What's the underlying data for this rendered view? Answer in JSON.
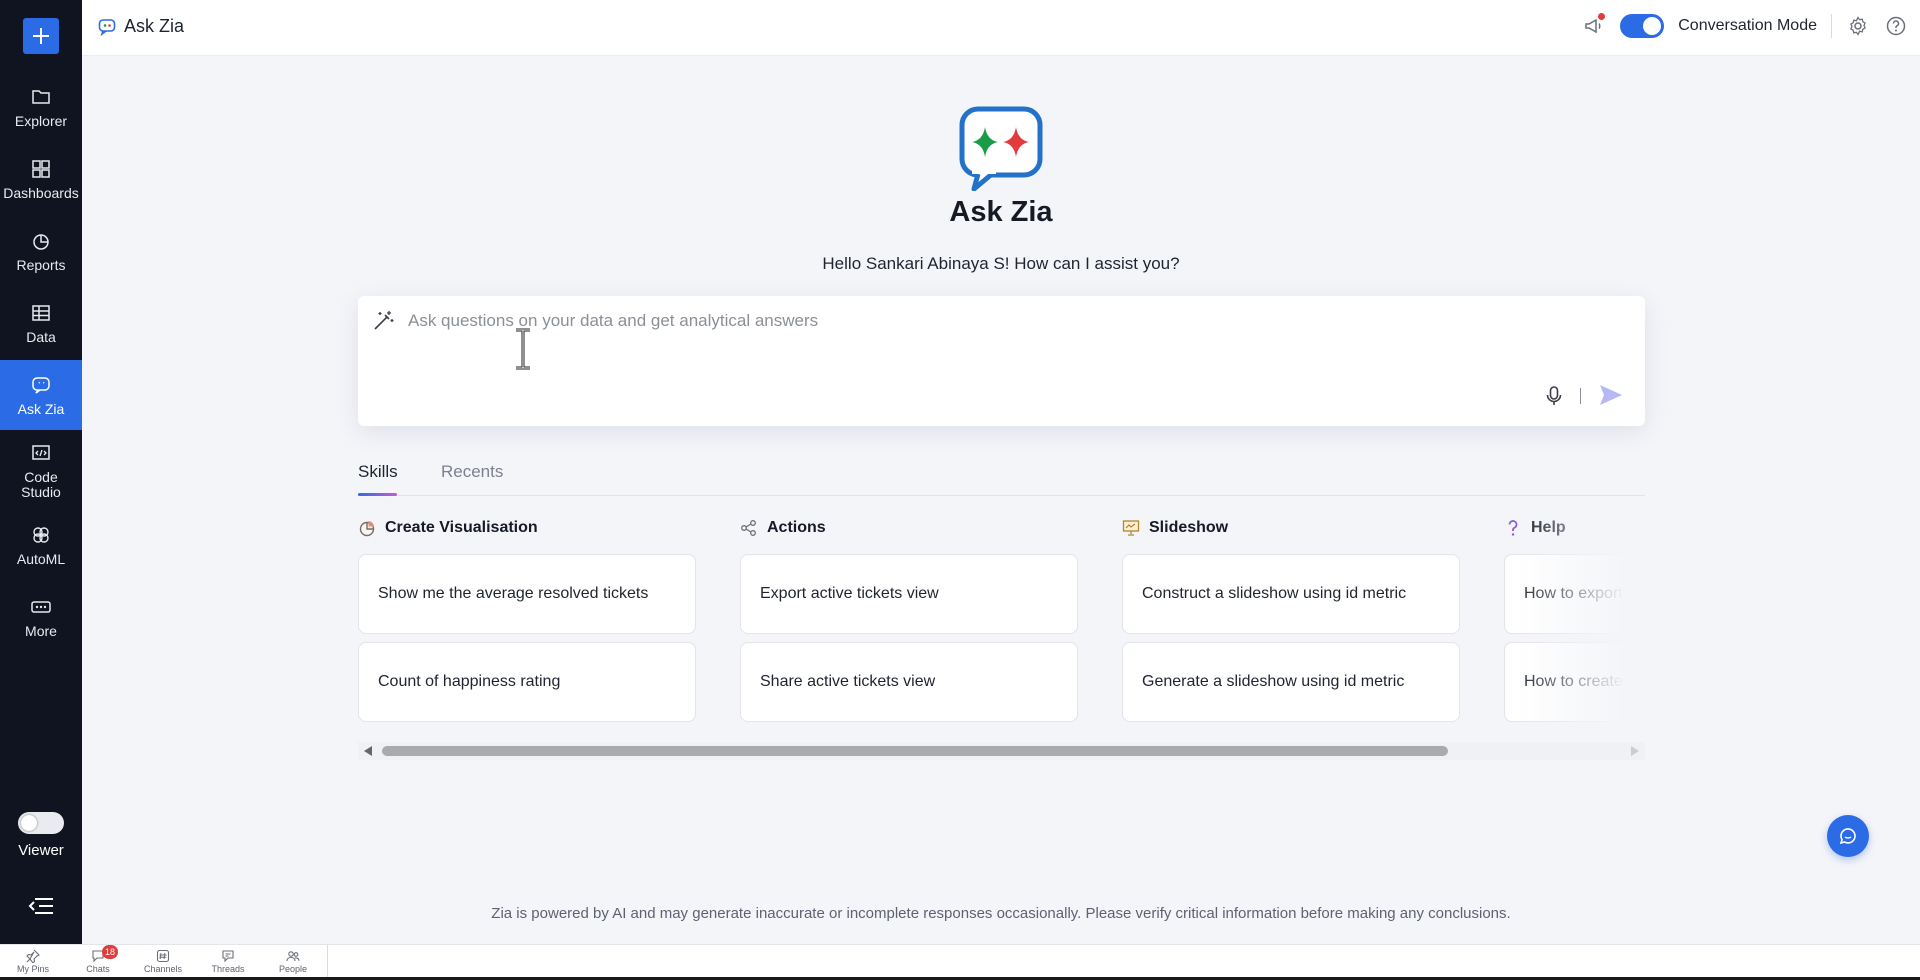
{
  "sidebar": {
    "items": [
      {
        "label": "Explorer"
      },
      {
        "label": "Dashboards"
      },
      {
        "label": "Reports"
      },
      {
        "label": "Data"
      },
      {
        "label": "Ask Zia"
      },
      {
        "label": "Code Studio"
      },
      {
        "label": "AutoML"
      },
      {
        "label": "More"
      }
    ],
    "viewer_label": "Viewer"
  },
  "header": {
    "title": "Ask Zia",
    "conversation_mode_label": "Conversation Mode"
  },
  "main": {
    "title": "Ask Zia",
    "greeting": "Hello Sankari Abinaya S! How can I assist you?",
    "input_placeholder": "Ask questions on your data and get analytical answers",
    "tabs": [
      {
        "label": "Skills"
      },
      {
        "label": "Recents"
      }
    ],
    "skills": [
      {
        "title": "Create Visualisation",
        "items": [
          "Show me the average resolved tickets",
          "Count of happiness rating"
        ]
      },
      {
        "title": "Actions",
        "items": [
          "Export active tickets view",
          "Share active tickets view"
        ]
      },
      {
        "title": "Slideshow",
        "items": [
          "Construct a slideshow using id metric",
          "Generate a slideshow using id metric"
        ]
      },
      {
        "title": "Help",
        "items": [
          "How to export m",
          "How to create a r"
        ]
      }
    ],
    "disclaimer": "Zia is powered by AI and may generate inaccurate or incomplete responses occasionally. Please verify critical information before making any conclusions."
  },
  "bottombar": {
    "items": [
      {
        "label": "My Pins"
      },
      {
        "label": "Chats",
        "badge": "18"
      },
      {
        "label": "Channels"
      },
      {
        "label": "Threads"
      },
      {
        "label": "People"
      }
    ]
  },
  "colors": {
    "accent": "#2b6be6",
    "sidebar_bg": "#0f1420",
    "page_bg": "#f4f5f9",
    "badge_red": "#e23b3b"
  }
}
